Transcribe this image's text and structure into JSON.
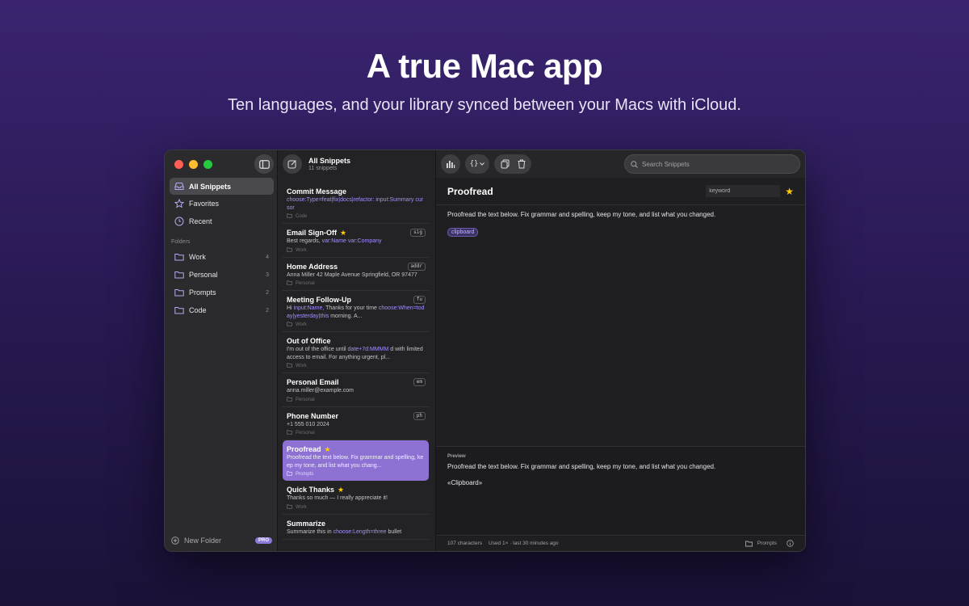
{
  "hero": {
    "title": "A true Mac app",
    "subtitle": "Ten languages, and your library synced between your Macs with iCloud."
  },
  "sidebar": {
    "nav": [
      {
        "label": "All Snippets",
        "icon": "tray-icon",
        "active": true
      },
      {
        "label": "Favorites",
        "icon": "star-outline-icon",
        "active": false
      },
      {
        "label": "Recent",
        "icon": "clock-icon",
        "active": false
      }
    ],
    "folders_label": "Folders",
    "folders": [
      {
        "label": "Work",
        "count": "4"
      },
      {
        "label": "Personal",
        "count": "3"
      },
      {
        "label": "Prompts",
        "count": "2"
      },
      {
        "label": "Code",
        "count": "2"
      }
    ],
    "new_folder": "New Folder",
    "pro_badge": "PRO"
  },
  "list": {
    "title": "All Snippets",
    "subtitle": "11 snippets",
    "items": [
      {
        "title": "Commit Message",
        "star": false,
        "abbr": "",
        "body": "choose:Type=feat|fix|docs|refactor: input:Summary cursor",
        "folder": "Code"
      },
      {
        "title": "Email Sign-Off",
        "star": true,
        "abbr": "sig",
        "body": "Best regards, var:Name var:Company",
        "folder": "Work"
      },
      {
        "title": "Home Address",
        "star": false,
        "abbr": "addr",
        "body": "Anna Miller 42 Maple Avenue Springfield, OR 97477",
        "folder": "Personal"
      },
      {
        "title": "Meeting Follow-Up",
        "star": false,
        "abbr": "fu",
        "body": "Hi input:Name, Thanks for your time choose:When=today|yesterday|this morning. A...",
        "folder": "Work"
      },
      {
        "title": "Out of Office",
        "star": false,
        "abbr": "",
        "body": "I'm out of the office until date+7d:MMMM d with limited access to email. For anything urgent, pl...",
        "folder": "Work"
      },
      {
        "title": "Personal Email",
        "star": false,
        "abbr": "em",
        "body": "anna.miller@example.com",
        "folder": "Personal"
      },
      {
        "title": "Phone Number",
        "star": false,
        "abbr": "ph",
        "body": "+1 555 010 2024",
        "folder": "Personal"
      },
      {
        "title": "Proofread",
        "star": true,
        "abbr": "",
        "body": "Proofread the text below. Fix grammar and spelling, keep my tone, and list what you chang...",
        "folder": "Prompts",
        "selected": true
      },
      {
        "title": "Quick Thanks",
        "star": true,
        "abbr": "",
        "body": "Thanks so much — I really appreciate it!",
        "folder": "Work"
      },
      {
        "title": "Summarize",
        "star": false,
        "abbr": "",
        "body": "Summarize this in choose:Length=three bullet",
        "folder": ""
      }
    ]
  },
  "detail": {
    "search_placeholder": "Search Snippets",
    "title": "Proofread",
    "keyword_placeholder": "keyword",
    "content": "Proofread the text below. Fix grammar and spelling, keep my tone, and list what you changed.",
    "token": "clipboard",
    "preview_label": "Preview",
    "preview_text": "Proofread the text below. Fix grammar and spelling, keep my tone, and list what you changed.",
    "preview_token": "«Clipboard»",
    "status": {
      "chars": "107 characters",
      "usage": "Used 1× · last 30 minutes ago",
      "folder": "Prompts"
    }
  },
  "colors": {
    "accent": "#8d72d4",
    "star": "#ffcc00",
    "variable": "#a58dff"
  }
}
